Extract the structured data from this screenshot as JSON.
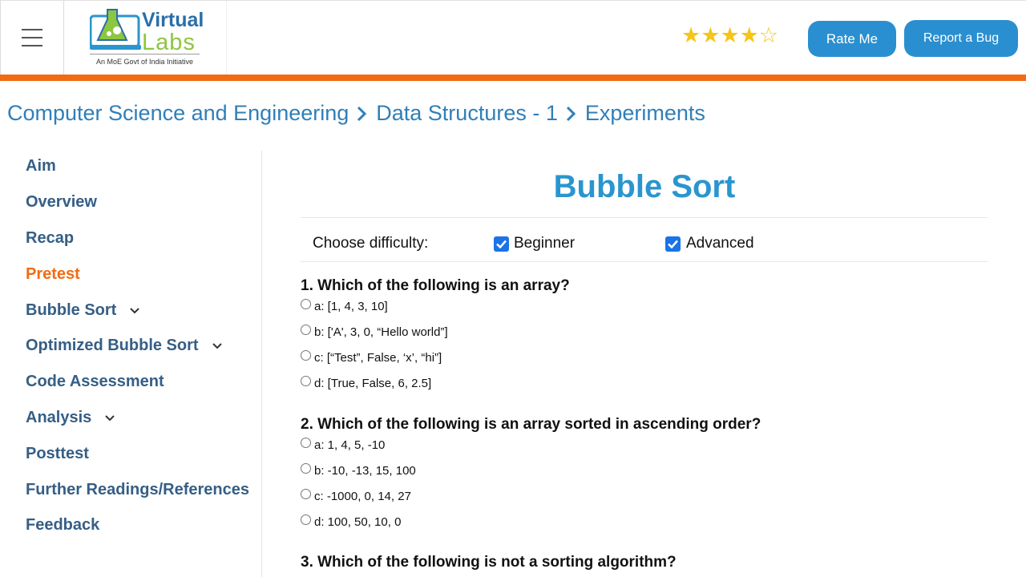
{
  "header": {
    "logo": {
      "line1": "Virtual",
      "line2": "Labs",
      "tagline": "An MoE Govt of India Initiative"
    },
    "rating": {
      "filled": 4,
      "total": 5
    },
    "rate_label": "Rate Me",
    "bug_label": "Report a Bug",
    "accent_color": "#f26b14",
    "button_color": "#2a8fd0"
  },
  "breadcrumb": [
    "Computer Science and Engineering",
    "Data Structures - 1",
    "Experiments"
  ],
  "sidebar": {
    "items": [
      {
        "label": "Aim",
        "expandable": false,
        "active": false
      },
      {
        "label": "Overview",
        "expandable": false,
        "active": false
      },
      {
        "label": "Recap",
        "expandable": false,
        "active": false
      },
      {
        "label": "Pretest",
        "expandable": false,
        "active": true
      },
      {
        "label": "Bubble Sort",
        "expandable": true,
        "active": false
      },
      {
        "label": "Optimized Bubble Sort",
        "expandable": true,
        "active": false
      },
      {
        "label": "Code Assessment",
        "expandable": false,
        "active": false
      },
      {
        "label": "Analysis",
        "expandable": true,
        "active": false
      },
      {
        "label": "Posttest",
        "expandable": false,
        "active": false
      },
      {
        "label": "Further Readings/References",
        "expandable": false,
        "active": false
      },
      {
        "label": "Feedback",
        "expandable": false,
        "active": false
      }
    ]
  },
  "main": {
    "title": "Bubble Sort",
    "difficulty": {
      "label": "Choose difficulty:",
      "options": [
        {
          "label": "Beginner",
          "checked": true
        },
        {
          "label": "Advanced",
          "checked": true
        }
      ]
    },
    "questions": [
      {
        "text": "1. Which of the following is an array?",
        "options": [
          "a: [1, 4, 3, 10]",
          "b: ['A', 3, 0, “Hello world”]",
          "c: [“Test”, False, ‘x’, “hi”]",
          "d: [True, False, 6, 2.5]"
        ]
      },
      {
        "text": "2. Which of the following is an array sorted in ascending order?",
        "options": [
          "a: 1, 4, 5, -10",
          "b: -10, -13, 15, 100",
          "c: -1000, 0, 14, 27",
          "d: 100, 50, 10, 0"
        ]
      },
      {
        "text": "3. Which of the following is not a sorting algorithm?",
        "options": []
      }
    ]
  }
}
